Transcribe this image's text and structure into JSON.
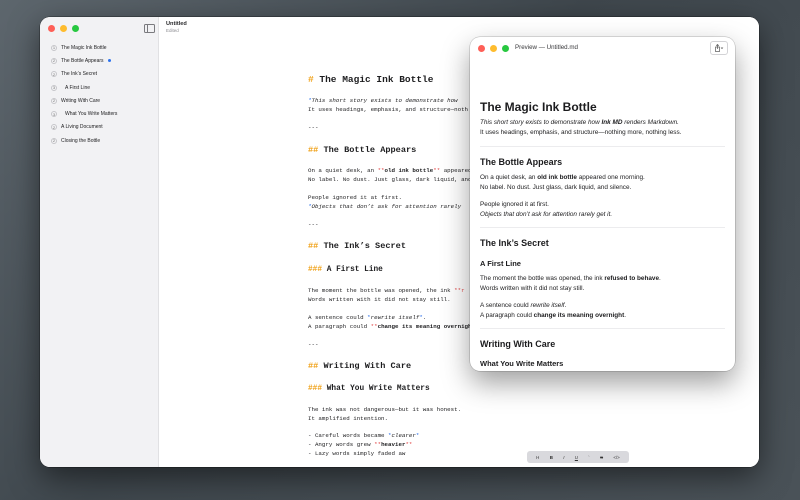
{
  "sidebar": {
    "items": [
      {
        "level": "1",
        "label": "The Magic Ink Bottle",
        "active": false
      },
      {
        "level": "2",
        "label": "The Bottle Appears",
        "active": true
      },
      {
        "level": "2",
        "label": "The Ink’s Secret",
        "active": false
      },
      {
        "level": "3",
        "label": "A First Line",
        "active": false
      },
      {
        "level": "2",
        "label": "Writing With Care",
        "active": false
      },
      {
        "level": "3",
        "label": "What You Write Matters",
        "active": false
      },
      {
        "level": "2",
        "label": "A Living Document",
        "active": false
      },
      {
        "level": "2",
        "label": "Closing the Bottle",
        "active": false
      }
    ]
  },
  "document": {
    "title": "Untitled",
    "status": "Edited"
  },
  "editor": {
    "h1_mark": "# ",
    "h1_text": "The Magic Ink Bottle",
    "intro_mark_open": "*",
    "intro_line1_text": "This short story exists to demonstrate how ",
    "intro_line2": "It uses headings, emphasis, and structure—noth",
    "hr1": "---",
    "h2a_mark": "## ",
    "h2a_text": "The Bottle Appears",
    "p1_l1_pre": "On a quiet desk, an ",
    "p1_l1_mark": "**",
    "p1_l1_bold": "old ink bottle",
    "p1_l1_mark2": "**",
    "p1_l1_post": " appeared",
    "p1_l2": "No label. No dust. Just glass, dark liquid, and",
    "p2_l1": "People ignored it at first.",
    "p2_l2_mark": "*",
    "p2_l2_italic": "Objects that don’t ask for attention rarely",
    "hr2": "---",
    "h2b_mark": "## ",
    "h2b_text": "The Ink’s Secret",
    "h3a_mark": "### ",
    "h3a_text": "A First Line",
    "p3_l1_pre": "The moment the bottle was opened, the ink ",
    "p3_l1_mark": "**r",
    "p3_l2": "Words written with it did not stay still.",
    "p4_l1_pre": "A sentence could ",
    "p4_l1_mark": "*",
    "p4_l1_italic": "rewrite itself",
    "p4_l1_mark2": "*",
    "p4_l1_post": ".",
    "p4_l2_pre": "A paragraph could ",
    "p4_l2_mark": "**",
    "p4_l2_bold": "change its meaning overnight",
    "hr3": "---",
    "h2c_mark": "## ",
    "h2c_text": "Writing With Care",
    "h3b_mark": "### ",
    "h3b_text": "What You Write Matters",
    "p5_l1": "The ink was not dangerous—but it was honest.",
    "p5_l2": "It amplified intention.",
    "li1_pre": "- Careful words became ",
    "li1_mark": "*",
    "li1_italic": "clearer",
    "li1_mark2": "*",
    "li2_pre": "- Angry words grew ",
    "li2_mark": "**",
    "li2_bold": "heavier",
    "li2_mark2": "**",
    "li3_pre": "- Lazy words simply faded aw"
  },
  "format_bar": [
    "H",
    "B",
    "I",
    "U",
    "`",
    "S",
    "</>"
  ],
  "preview": {
    "window_title": "Preview — Untitled.md",
    "h1": "The Magic Ink Bottle",
    "intro_l1_pre": "This short story exists to demonstrate how ",
    "intro_l1_bold": "Ink MD",
    "intro_l1_post": " renders Markdown.",
    "intro_l2": "It uses headings, emphasis, and structure—nothing more, nothing less.",
    "h2a": "The Bottle Appears",
    "p1_l1_pre": "On a quiet desk, an ",
    "p1_l1_bold": "old ink bottle",
    "p1_l1_post": " appeared one morning.",
    "p1_l2": "No label. No dust. Just glass, dark liquid, and silence.",
    "p2_l1": "People ignored it at first.",
    "p2_l2": "Objects that don’t ask for attention rarely get it.",
    "h2b": "The Ink’s Secret",
    "h3a": "A First Line",
    "p3_l1_pre": "The moment the bottle was opened, the ink ",
    "p3_l1_bold": "refused to behave",
    "p3_l1_post": ".",
    "p3_l2": "Words written with it did not stay still.",
    "p4_l1_pre": "A sentence could ",
    "p4_l1_italic": "rewrite itself",
    "p4_l1_post": ".",
    "p4_l2_pre": "A paragraph could ",
    "p4_l2_bold": "change its meaning overnight",
    "p4_l2_post": ".",
    "h2c": "Writing With Care",
    "h3b": "What You Write Matters"
  },
  "colors": {
    "accent": "#2c72ee",
    "markdown_marker": "#f0a21a",
    "emphasis_marker": "#e24a4a"
  },
  "icons": {
    "sidebar_toggle": "sidebar-toggle-icon",
    "share": "share-icon"
  }
}
